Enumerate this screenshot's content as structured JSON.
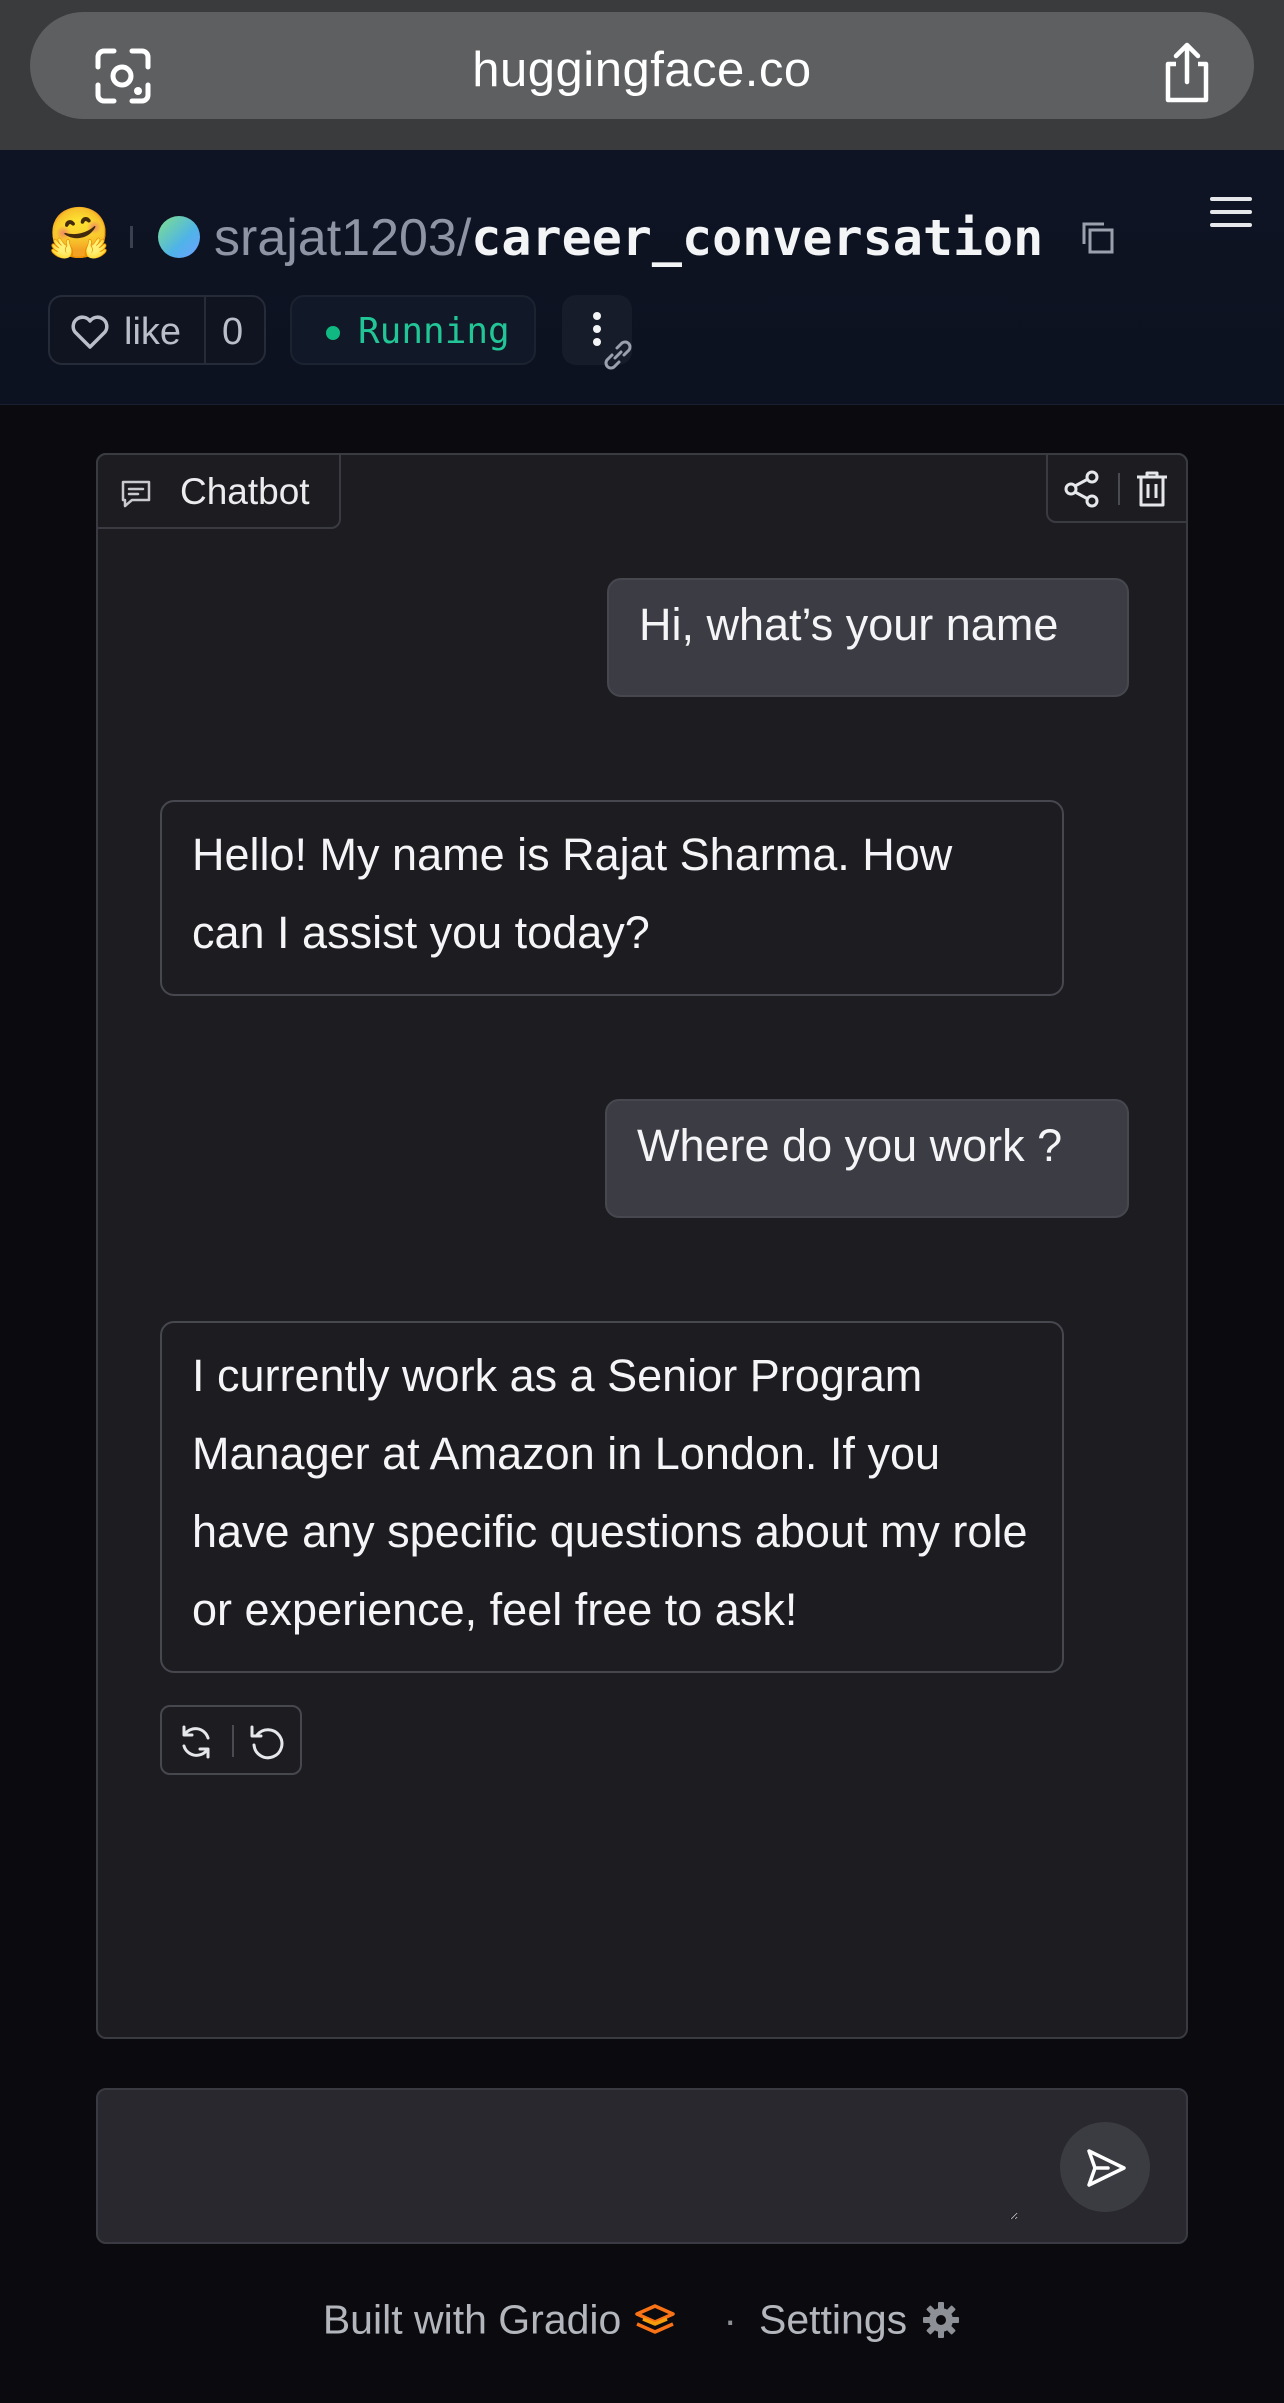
{
  "browser": {
    "url": "huggingface.co"
  },
  "header": {
    "logo_emoji": "🤗",
    "owner": "srajat1203",
    "separator": "/",
    "space_name": "career_conversation",
    "like_label": "like",
    "like_count": "0",
    "status": "Running"
  },
  "chat": {
    "tab_label": "Chatbot",
    "messages": [
      {
        "role": "user",
        "text": "Hi, what’s your name"
      },
      {
        "role": "assistant",
        "text": "Hello! My name is Rajat Sharma. How can I assist you today?"
      },
      {
        "role": "user",
        "text": "Where do you work ?"
      },
      {
        "role": "assistant",
        "text": "I currently work as a Senior Program Manager at Amazon in London. If you have any specific questions about my role or experience, feel free to ask!"
      }
    ]
  },
  "input": {
    "value": "",
    "placeholder": ""
  },
  "footer": {
    "built_with": "Built with Gradio",
    "dot": "·",
    "settings": "Settings"
  },
  "colors": {
    "running_green": "#22c596",
    "gradio_orange": "#f97316",
    "user_bubble": "#3c3d44",
    "panel_bg": "#1c1c21"
  }
}
